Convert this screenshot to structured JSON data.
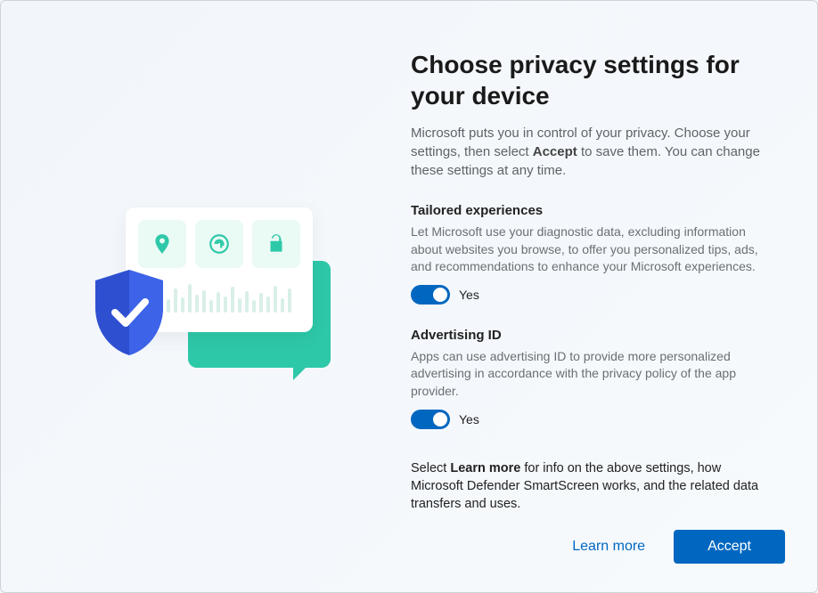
{
  "heading": "Choose privacy settings for your device",
  "intro_pre": "Microsoft puts you in control of your privacy. Choose your settings, then select ",
  "intro_bold": "Accept",
  "intro_post": " to save them. You can change these settings at any time.",
  "sections": [
    {
      "title": "Tailored experiences",
      "desc": "Let Microsoft use your diagnostic data, excluding information about websites you browse, to offer you personalized tips, ads, and recommendations to enhance your Microsoft experiences.",
      "state_label": "Yes"
    },
    {
      "title": "Advertising ID",
      "desc": "Apps can use advertising ID to provide more personalized advertising in accordance with the privacy policy of the app provider.",
      "state_label": "Yes"
    }
  ],
  "footnote_pre": "Select ",
  "footnote_bold": "Learn more",
  "footnote_post": " for info on the above settings, how Microsoft Defender SmartScreen works, and the related data transfers and uses.",
  "buttons": {
    "learn_more": "Learn more",
    "accept": "Accept"
  },
  "colors": {
    "accent": "#0067c0",
    "teal": "#2dc8a8"
  }
}
